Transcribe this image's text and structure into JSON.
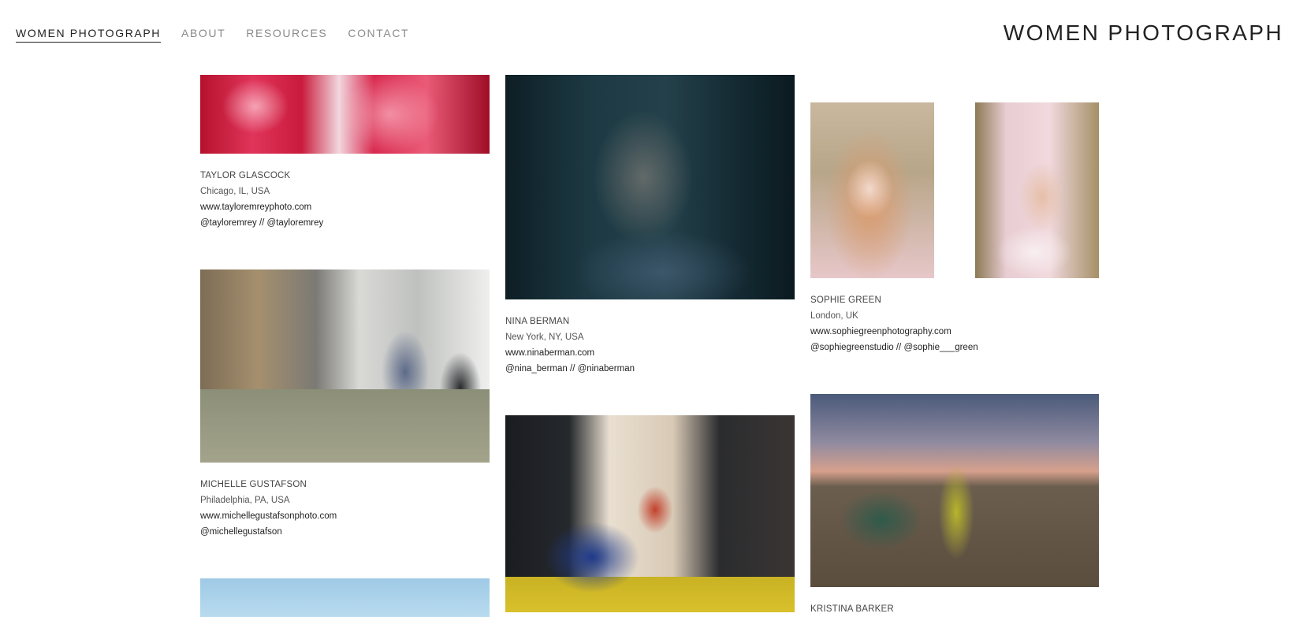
{
  "nav": {
    "items": [
      {
        "label": "WOMEN PHOTOGRAPH"
      },
      {
        "label": "ABOUT"
      },
      {
        "label": "RESOURCES"
      },
      {
        "label": "CONTACT"
      }
    ],
    "brand": "WOMEN PHOTOGRAPH"
  },
  "photographers": {
    "taylor": {
      "name": "TAYLOR GLASCOCK",
      "location": "Chicago, IL, USA",
      "website": "www.tayloremreyphoto.com",
      "social": "@tayloremrey  //  @tayloremrey"
    },
    "michelle": {
      "name": "MICHELLE GUSTAFSON",
      "location": "Philadelphia, PA, USA",
      "website": "www.michellegustafsonphoto.com",
      "social": "@michellegustafson"
    },
    "nina": {
      "name": "NINA BERMAN",
      "location": "New York, NY, USA",
      "website": "www.ninaberman.com",
      "social": "@nina_berman  //  @ninaberman"
    },
    "sophie": {
      "name": "SOPHIE GREEN",
      "location": "London, UK",
      "website": "www.sophiegreenphotography.com",
      "social": "@sophiegreenstudio  //  @sophie___green"
    },
    "kristina": {
      "name": "KRISTINA BARKER"
    }
  }
}
